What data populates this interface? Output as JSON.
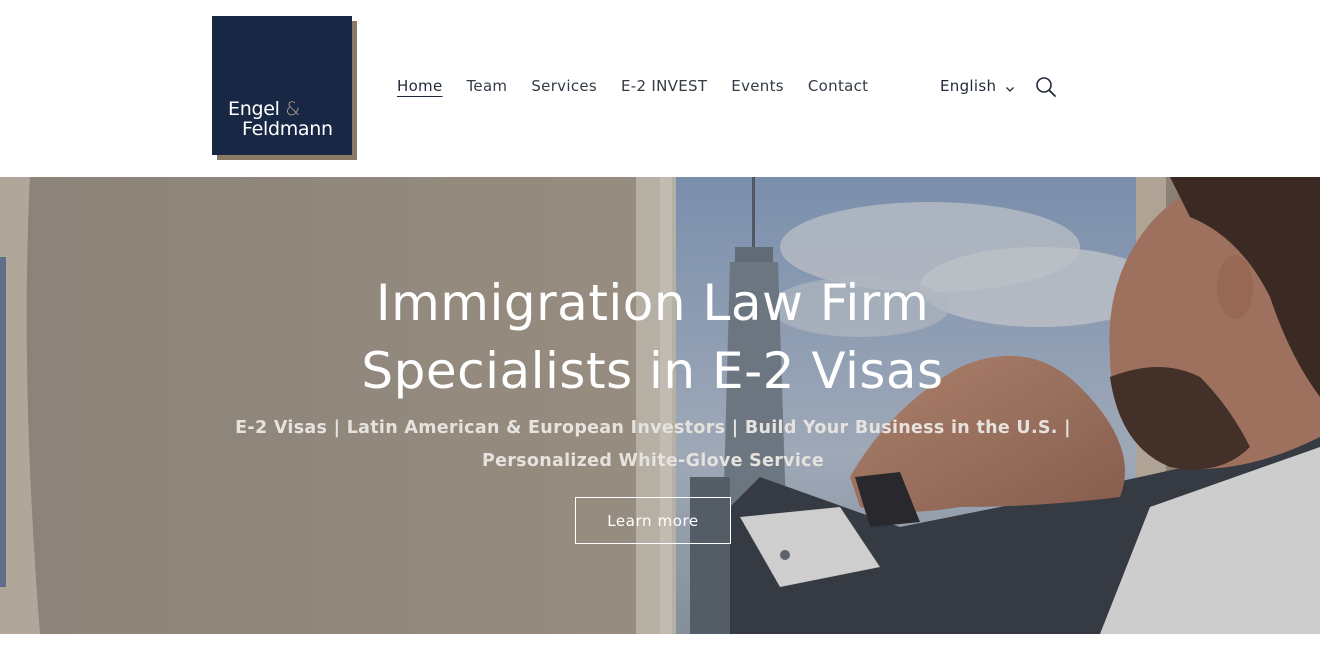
{
  "brand": {
    "line1": "Engel",
    "amp": "&",
    "line2": "Feldmann",
    "colors": {
      "logo_bg": "#172744",
      "logo_shadow": "#8a7a68",
      "amp": "#b3a089"
    }
  },
  "nav": {
    "items": [
      {
        "label": "Home",
        "active": true
      },
      {
        "label": "Team"
      },
      {
        "label": "Services"
      },
      {
        "label": "E-2 INVEST"
      },
      {
        "label": "Events"
      },
      {
        "label": "Contact"
      }
    ],
    "language": "English",
    "icons": {
      "language_dropdown": "chevron-down-icon",
      "search": "search-icon"
    }
  },
  "hero": {
    "title_line1": "Immigration Law Firm",
    "title_line2": "Specialists in E-2 Visas",
    "subtitle_line1": "E-2 Visas | Latin American & European Investors | Build Your Business in the U.S. |",
    "subtitle_line2": "Personalized White-Glove Service",
    "button_label": "Learn more"
  }
}
